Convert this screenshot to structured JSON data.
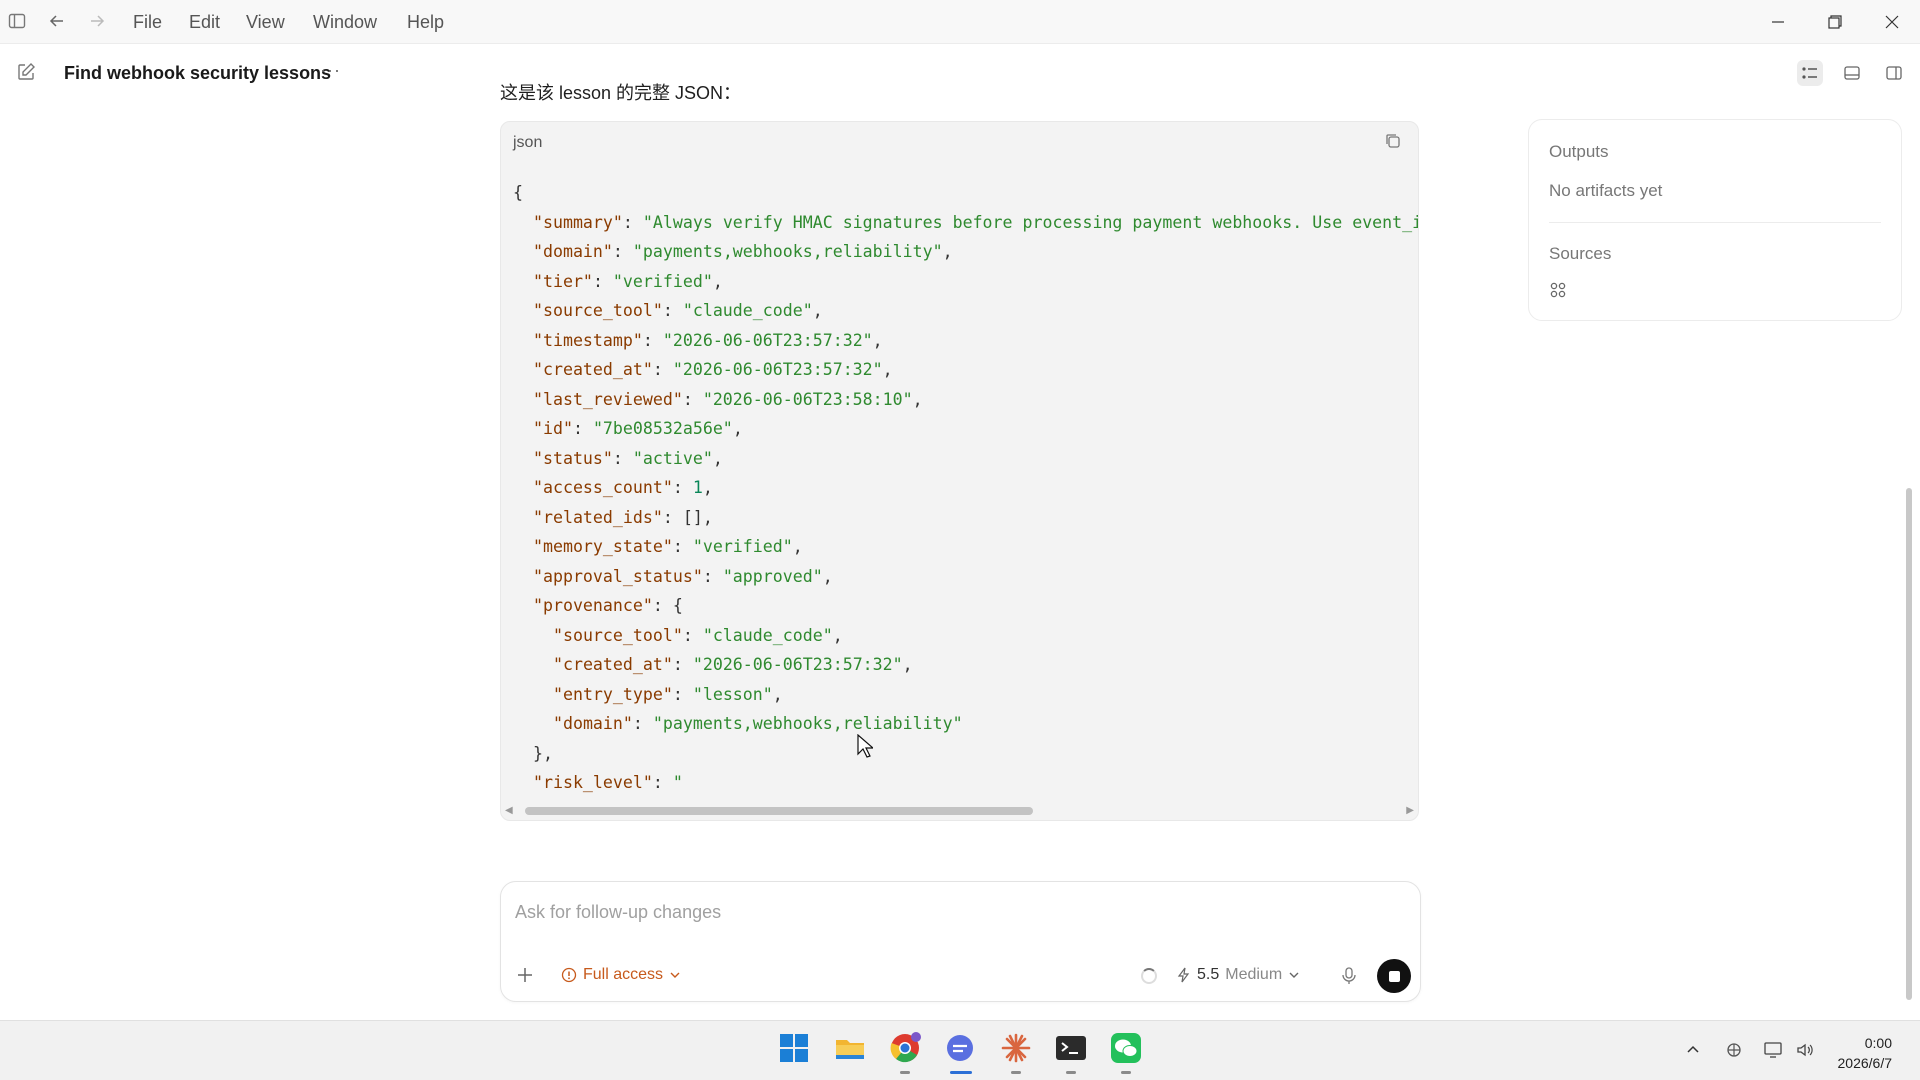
{
  "menu": [
    "File",
    "Edit",
    "View",
    "Window",
    "Help"
  ],
  "conversation": {
    "title": "Find webhook security lessons",
    "more_label": "···"
  },
  "chat": {
    "intro": "这是该 lesson 的完整 JSON：",
    "code_lang": "json",
    "code_lines": [
      {
        "indent": 0,
        "parts": [
          {
            "t": "p",
            "v": "{"
          }
        ]
      },
      {
        "indent": 1,
        "parts": [
          {
            "t": "k",
            "v": "\"summary\""
          },
          {
            "t": "p",
            "v": ": "
          },
          {
            "t": "s",
            "v": "\"Always verify HMAC signatures before processing payment webhooks. Use event_id fo"
          }
        ]
      },
      {
        "indent": 1,
        "parts": [
          {
            "t": "k",
            "v": "\"domain\""
          },
          {
            "t": "p",
            "v": ": "
          },
          {
            "t": "s",
            "v": "\"payments,webhooks,reliability\""
          },
          {
            "t": "p",
            "v": ","
          }
        ]
      },
      {
        "indent": 1,
        "parts": [
          {
            "t": "k",
            "v": "\"tier\""
          },
          {
            "t": "p",
            "v": ": "
          },
          {
            "t": "s",
            "v": "\"verified\""
          },
          {
            "t": "p",
            "v": ","
          }
        ]
      },
      {
        "indent": 1,
        "parts": [
          {
            "t": "k",
            "v": "\"source_tool\""
          },
          {
            "t": "p",
            "v": ": "
          },
          {
            "t": "s",
            "v": "\"claude_code\""
          },
          {
            "t": "p",
            "v": ","
          }
        ]
      },
      {
        "indent": 1,
        "parts": [
          {
            "t": "k",
            "v": "\"timestamp\""
          },
          {
            "t": "p",
            "v": ": "
          },
          {
            "t": "s",
            "v": "\"2026-06-06T23:57:32\""
          },
          {
            "t": "p",
            "v": ","
          }
        ]
      },
      {
        "indent": 1,
        "parts": [
          {
            "t": "k",
            "v": "\"created_at\""
          },
          {
            "t": "p",
            "v": ": "
          },
          {
            "t": "s",
            "v": "\"2026-06-06T23:57:32\""
          },
          {
            "t": "p",
            "v": ","
          }
        ]
      },
      {
        "indent": 1,
        "parts": [
          {
            "t": "k",
            "v": "\"last_reviewed\""
          },
          {
            "t": "p",
            "v": ": "
          },
          {
            "t": "s",
            "v": "\"2026-06-06T23:58:10\""
          },
          {
            "t": "p",
            "v": ","
          }
        ]
      },
      {
        "indent": 1,
        "parts": [
          {
            "t": "k",
            "v": "\"id\""
          },
          {
            "t": "p",
            "v": ": "
          },
          {
            "t": "s",
            "v": "\"7be08532a56e\""
          },
          {
            "t": "p",
            "v": ","
          }
        ]
      },
      {
        "indent": 1,
        "parts": [
          {
            "t": "k",
            "v": "\"status\""
          },
          {
            "t": "p",
            "v": ": "
          },
          {
            "t": "s",
            "v": "\"active\""
          },
          {
            "t": "p",
            "v": ","
          }
        ]
      },
      {
        "indent": 1,
        "parts": [
          {
            "t": "k",
            "v": "\"access_count\""
          },
          {
            "t": "p",
            "v": ": "
          },
          {
            "t": "n",
            "v": "1"
          },
          {
            "t": "p",
            "v": ","
          }
        ]
      },
      {
        "indent": 1,
        "parts": [
          {
            "t": "k",
            "v": "\"related_ids\""
          },
          {
            "t": "p",
            "v": ": [],"
          }
        ]
      },
      {
        "indent": 1,
        "parts": [
          {
            "t": "k",
            "v": "\"memory_state\""
          },
          {
            "t": "p",
            "v": ": "
          },
          {
            "t": "s",
            "v": "\"verified\""
          },
          {
            "t": "p",
            "v": ","
          }
        ]
      },
      {
        "indent": 1,
        "parts": [
          {
            "t": "k",
            "v": "\"approval_status\""
          },
          {
            "t": "p",
            "v": ": "
          },
          {
            "t": "s",
            "v": "\"approved\""
          },
          {
            "t": "p",
            "v": ","
          }
        ]
      },
      {
        "indent": 1,
        "parts": [
          {
            "t": "k",
            "v": "\"provenance\""
          },
          {
            "t": "p",
            "v": ": {"
          }
        ]
      },
      {
        "indent": 2,
        "parts": [
          {
            "t": "k",
            "v": "\"source_tool\""
          },
          {
            "t": "p",
            "v": ": "
          },
          {
            "t": "s",
            "v": "\"claude_code\""
          },
          {
            "t": "p",
            "v": ","
          }
        ]
      },
      {
        "indent": 2,
        "parts": [
          {
            "t": "k",
            "v": "\"created_at\""
          },
          {
            "t": "p",
            "v": ": "
          },
          {
            "t": "s",
            "v": "\"2026-06-06T23:57:32\""
          },
          {
            "t": "p",
            "v": ","
          }
        ]
      },
      {
        "indent": 2,
        "parts": [
          {
            "t": "k",
            "v": "\"entry_type\""
          },
          {
            "t": "p",
            "v": ": "
          },
          {
            "t": "s",
            "v": "\"lesson\""
          },
          {
            "t": "p",
            "v": ","
          }
        ]
      },
      {
        "indent": 2,
        "parts": [
          {
            "t": "k",
            "v": "\"domain\""
          },
          {
            "t": "p",
            "v": ": "
          },
          {
            "t": "s",
            "v": "\"payments,webhooks,reliability\""
          }
        ]
      },
      {
        "indent": 1,
        "parts": [
          {
            "t": "p",
            "v": "},"
          }
        ]
      },
      {
        "indent": 1,
        "parts": [
          {
            "t": "k",
            "v": "\"risk_level\""
          },
          {
            "t": "p",
            "v": ": "
          },
          {
            "t": "s",
            "v": "\""
          }
        ]
      }
    ]
  },
  "side_panel": {
    "outputs_label": "Outputs",
    "outputs_value": "No artifacts yet",
    "sources_label": "Sources"
  },
  "composer": {
    "placeholder": "Ask for follow-up changes",
    "access_label": "Full access",
    "model_version": "5.5",
    "model_effort": "Medium"
  },
  "taskbar": {
    "time": "0:00",
    "date": "2026/6/7"
  }
}
